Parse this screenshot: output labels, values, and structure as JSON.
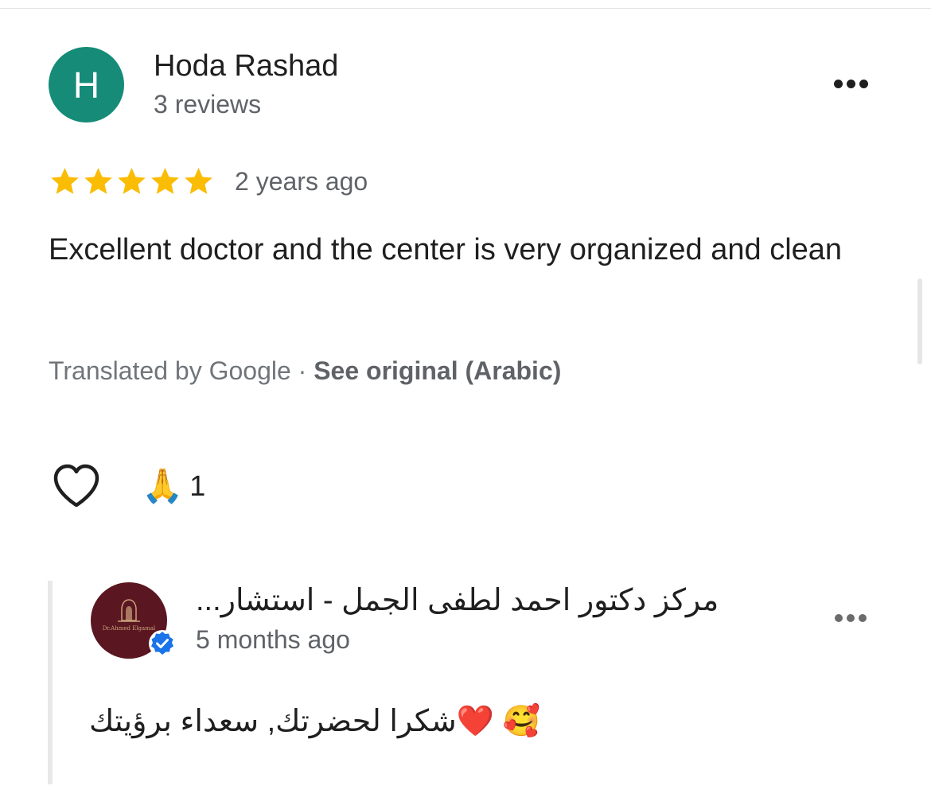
{
  "review": {
    "avatar_letter": "H",
    "avatar_color": "#158b78",
    "reviewer_name": "Hoda Rashad",
    "review_count": "3 reviews",
    "rating": 5,
    "max_rating": 5,
    "star_color": "#fbbc04",
    "time": "2 years ago",
    "text": "Excellent doctor and the center is very organized and clean",
    "translation_label": "Translated by Google · ",
    "see_original": "See original (Arabic)",
    "reaction_emoji": "🙏",
    "reaction_count": "1",
    "more_icon": "more-horizontal-icon",
    "like_icon": "heart-outline-icon"
  },
  "owner_reply": {
    "name": "مركز دكتور احمد لطفى الجمل - استشار...",
    "time": "5 months ago",
    "text": "🥰 ❤️شكرا لحضرتك, سعداء برؤيتك",
    "avatar_color": "#5a1621",
    "logo_text": "Dr.Ahmed Elgamal",
    "verified_icon": "verified-badge-icon",
    "more_icon": "more-horizontal-icon"
  }
}
